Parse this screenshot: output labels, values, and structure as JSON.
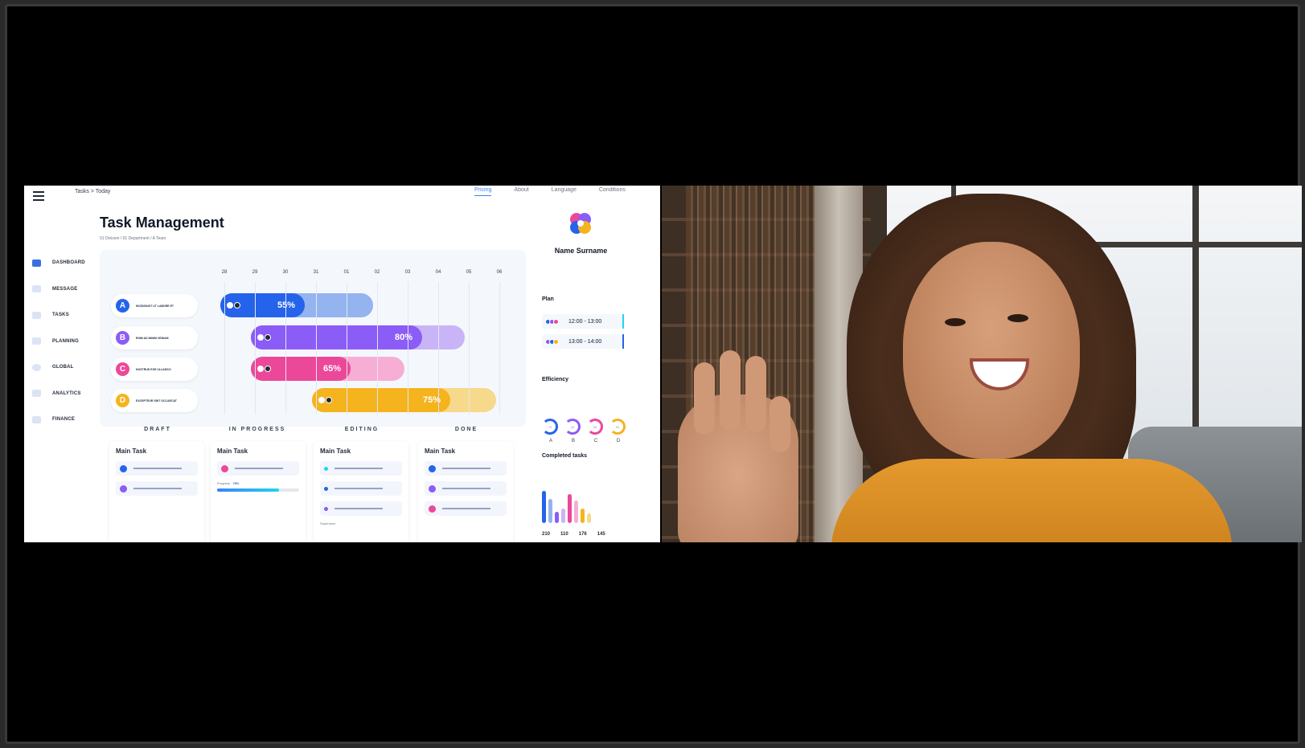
{
  "app": {
    "breadcrumb_top": "Tasks  >  Today",
    "nav": [
      "Pricing",
      "About",
      "Language",
      "Conditions"
    ],
    "title": "Task Management",
    "sub_breadcrumb": "01 Division  /  01 Department  /  A Team",
    "sidebar": [
      "DASHBOARD",
      "MESSAGE",
      "TASKS",
      "PLANNING",
      "GLOBAL",
      "ANALYTICS",
      "FINANCE"
    ],
    "days": [
      "28",
      "29",
      "30",
      "31",
      "01",
      "02",
      "03",
      "04",
      "05",
      "06"
    ],
    "tasks": [
      {
        "letter": "A",
        "text": "INCIDIDUNT UT LABORE ET",
        "percent": "55%",
        "color": "#2563eb",
        "light": "#93b4ee"
      },
      {
        "letter": "B",
        "text": "ENIM AD MINIM VENIAM",
        "percent": "80%",
        "color": "#8b5cf6",
        "light": "#c9b4f7"
      },
      {
        "letter": "C",
        "text": "NOSTRUD EXE ULLAMCO",
        "percent": "65%",
        "color": "#ec4899",
        "light": "#f6aed4"
      },
      {
        "letter": "D",
        "text": "EXCEPTEUR SINT OCCAECAT",
        "percent": "75%",
        "color": "#f5b31e",
        "light": "#f7d98b"
      }
    ],
    "kanban": {
      "columns": [
        "DRAFT",
        "IN PROGRESS",
        "EDITING",
        "DONE"
      ],
      "card_title": "Main Task",
      "progress_label": "Progress",
      "progress_value": "75%",
      "supervisor_label": "Supervisor"
    },
    "profile": {
      "name": "Name Surname"
    },
    "plan": {
      "label": "Plan",
      "slots": [
        "12:00 - 13:00",
        "13:00 - 14:00"
      ]
    },
    "efficiency": {
      "label": "Efficiency",
      "items": [
        {
          "letter": "A",
          "value": "75",
          "color": "#2563eb"
        },
        {
          "letter": "B",
          "value": "44",
          "color": "#8b5cf6"
        },
        {
          "letter": "C",
          "value": "68",
          "color": "#ec4899"
        },
        {
          "letter": "D",
          "value": "55",
          "color": "#f5b31e"
        }
      ]
    },
    "completed": {
      "label": "Completed tasks",
      "values": [
        "210",
        "110",
        "176",
        "145"
      ]
    }
  }
}
